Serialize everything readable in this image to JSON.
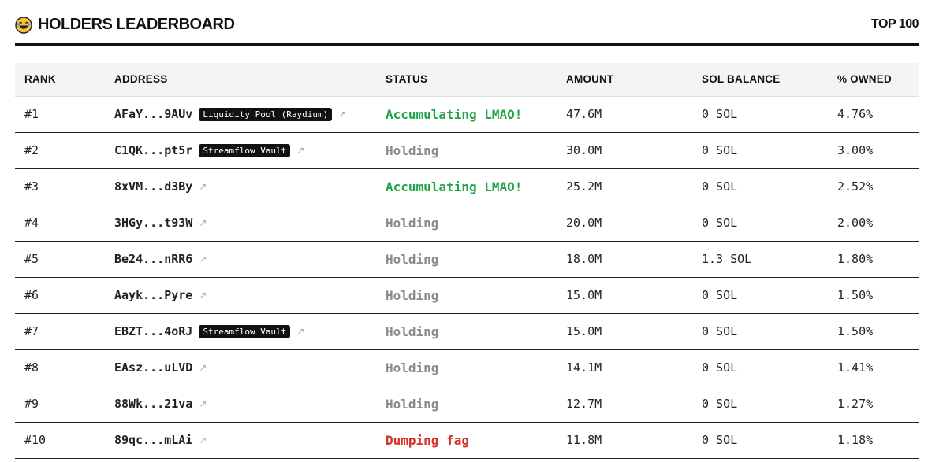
{
  "header": {
    "title": "HOLDERS LEADERBOARD",
    "badge": "TOP 100"
  },
  "columns": [
    "RANK",
    "ADDRESS",
    "STATUS",
    "AMOUNT",
    "SOL BALANCE",
    "% OWNED"
  ],
  "colors": {
    "accumulating": "#22a447",
    "holding": "#8a8a8a",
    "dumping": "#d6302a"
  },
  "rows": [
    {
      "rank": "#1",
      "address": "AFaY...9AUv",
      "tag": "Liquidity Pool (Raydium)",
      "status": "Accumulating LMAO!",
      "status_kind": "acc",
      "amount": "47.6M",
      "sol": "0 SOL",
      "owned": "4.76%"
    },
    {
      "rank": "#2",
      "address": "C1QK...pt5r",
      "tag": "Streamflow Vault",
      "status": "Holding",
      "status_kind": "hold",
      "amount": "30.0M",
      "sol": "0 SOL",
      "owned": "3.00%"
    },
    {
      "rank": "#3",
      "address": "8xVM...d3By",
      "tag": "",
      "status": "Accumulating LMAO!",
      "status_kind": "acc",
      "amount": "25.2M",
      "sol": "0 SOL",
      "owned": "2.52%"
    },
    {
      "rank": "#4",
      "address": "3HGy...t93W",
      "tag": "",
      "status": "Holding",
      "status_kind": "hold",
      "amount": "20.0M",
      "sol": "0 SOL",
      "owned": "2.00%"
    },
    {
      "rank": "#5",
      "address": "Be24...nRR6",
      "tag": "",
      "status": "Holding",
      "status_kind": "hold",
      "amount": "18.0M",
      "sol": "1.3 SOL",
      "owned": "1.80%"
    },
    {
      "rank": "#6",
      "address": "Aayk...Pyre",
      "tag": "",
      "status": "Holding",
      "status_kind": "hold",
      "amount": "15.0M",
      "sol": "0 SOL",
      "owned": "1.50%"
    },
    {
      "rank": "#7",
      "address": "EBZT...4oRJ",
      "tag": "Streamflow Vault",
      "status": "Holding",
      "status_kind": "hold",
      "amount": "15.0M",
      "sol": "0 SOL",
      "owned": "1.50%"
    },
    {
      "rank": "#8",
      "address": "EAsz...uLVD",
      "tag": "",
      "status": "Holding",
      "status_kind": "hold",
      "amount": "14.1M",
      "sol": "0 SOL",
      "owned": "1.41%"
    },
    {
      "rank": "#9",
      "address": "88Wk...21va",
      "tag": "",
      "status": "Holding",
      "status_kind": "hold",
      "amount": "12.7M",
      "sol": "0 SOL",
      "owned": "1.27%"
    },
    {
      "rank": "#10",
      "address": "89qc...mLAi",
      "tag": "",
      "status": "Dumping fag",
      "status_kind": "dump",
      "amount": "11.8M",
      "sol": "0 SOL",
      "owned": "1.18%"
    }
  ]
}
